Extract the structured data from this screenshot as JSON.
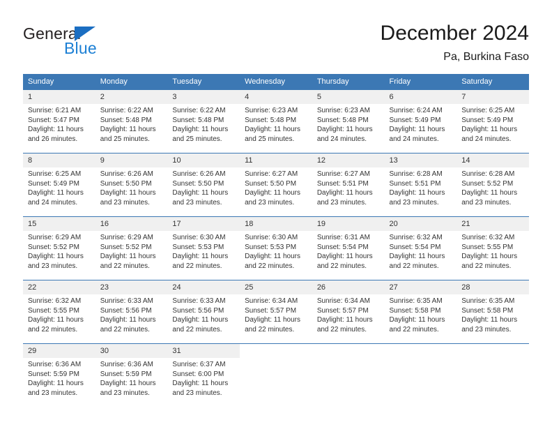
{
  "brand": {
    "name_top": "General",
    "name_bottom": "Blue",
    "accent_color": "#1b7fd4",
    "triangle_color": "#1b6ec2"
  },
  "header": {
    "title": "December 2024",
    "subtitle": "Pa, Burkina Faso",
    "header_bg": "#3c78b4",
    "daynum_bg": "#f0f0f0"
  },
  "weekdays": [
    "Sunday",
    "Monday",
    "Tuesday",
    "Wednesday",
    "Thursday",
    "Friday",
    "Saturday"
  ],
  "weeks": [
    [
      {
        "day": "1",
        "sunrise": "Sunrise: 6:21 AM",
        "sunset": "Sunset: 5:47 PM",
        "daylight1": "Daylight: 11 hours",
        "daylight2": "and 26 minutes."
      },
      {
        "day": "2",
        "sunrise": "Sunrise: 6:22 AM",
        "sunset": "Sunset: 5:48 PM",
        "daylight1": "Daylight: 11 hours",
        "daylight2": "and 25 minutes."
      },
      {
        "day": "3",
        "sunrise": "Sunrise: 6:22 AM",
        "sunset": "Sunset: 5:48 PM",
        "daylight1": "Daylight: 11 hours",
        "daylight2": "and 25 minutes."
      },
      {
        "day": "4",
        "sunrise": "Sunrise: 6:23 AM",
        "sunset": "Sunset: 5:48 PM",
        "daylight1": "Daylight: 11 hours",
        "daylight2": "and 25 minutes."
      },
      {
        "day": "5",
        "sunrise": "Sunrise: 6:23 AM",
        "sunset": "Sunset: 5:48 PM",
        "daylight1": "Daylight: 11 hours",
        "daylight2": "and 24 minutes."
      },
      {
        "day": "6",
        "sunrise": "Sunrise: 6:24 AM",
        "sunset": "Sunset: 5:49 PM",
        "daylight1": "Daylight: 11 hours",
        "daylight2": "and 24 minutes."
      },
      {
        "day": "7",
        "sunrise": "Sunrise: 6:25 AM",
        "sunset": "Sunset: 5:49 PM",
        "daylight1": "Daylight: 11 hours",
        "daylight2": "and 24 minutes."
      }
    ],
    [
      {
        "day": "8",
        "sunrise": "Sunrise: 6:25 AM",
        "sunset": "Sunset: 5:49 PM",
        "daylight1": "Daylight: 11 hours",
        "daylight2": "and 24 minutes."
      },
      {
        "day": "9",
        "sunrise": "Sunrise: 6:26 AM",
        "sunset": "Sunset: 5:50 PM",
        "daylight1": "Daylight: 11 hours",
        "daylight2": "and 23 minutes."
      },
      {
        "day": "10",
        "sunrise": "Sunrise: 6:26 AM",
        "sunset": "Sunset: 5:50 PM",
        "daylight1": "Daylight: 11 hours",
        "daylight2": "and 23 minutes."
      },
      {
        "day": "11",
        "sunrise": "Sunrise: 6:27 AM",
        "sunset": "Sunset: 5:50 PM",
        "daylight1": "Daylight: 11 hours",
        "daylight2": "and 23 minutes."
      },
      {
        "day": "12",
        "sunrise": "Sunrise: 6:27 AM",
        "sunset": "Sunset: 5:51 PM",
        "daylight1": "Daylight: 11 hours",
        "daylight2": "and 23 minutes."
      },
      {
        "day": "13",
        "sunrise": "Sunrise: 6:28 AM",
        "sunset": "Sunset: 5:51 PM",
        "daylight1": "Daylight: 11 hours",
        "daylight2": "and 23 minutes."
      },
      {
        "day": "14",
        "sunrise": "Sunrise: 6:28 AM",
        "sunset": "Sunset: 5:52 PM",
        "daylight1": "Daylight: 11 hours",
        "daylight2": "and 23 minutes."
      }
    ],
    [
      {
        "day": "15",
        "sunrise": "Sunrise: 6:29 AM",
        "sunset": "Sunset: 5:52 PM",
        "daylight1": "Daylight: 11 hours",
        "daylight2": "and 23 minutes."
      },
      {
        "day": "16",
        "sunrise": "Sunrise: 6:29 AM",
        "sunset": "Sunset: 5:52 PM",
        "daylight1": "Daylight: 11 hours",
        "daylight2": "and 22 minutes."
      },
      {
        "day": "17",
        "sunrise": "Sunrise: 6:30 AM",
        "sunset": "Sunset: 5:53 PM",
        "daylight1": "Daylight: 11 hours",
        "daylight2": "and 22 minutes."
      },
      {
        "day": "18",
        "sunrise": "Sunrise: 6:30 AM",
        "sunset": "Sunset: 5:53 PM",
        "daylight1": "Daylight: 11 hours",
        "daylight2": "and 22 minutes."
      },
      {
        "day": "19",
        "sunrise": "Sunrise: 6:31 AM",
        "sunset": "Sunset: 5:54 PM",
        "daylight1": "Daylight: 11 hours",
        "daylight2": "and 22 minutes."
      },
      {
        "day": "20",
        "sunrise": "Sunrise: 6:32 AM",
        "sunset": "Sunset: 5:54 PM",
        "daylight1": "Daylight: 11 hours",
        "daylight2": "and 22 minutes."
      },
      {
        "day": "21",
        "sunrise": "Sunrise: 6:32 AM",
        "sunset": "Sunset: 5:55 PM",
        "daylight1": "Daylight: 11 hours",
        "daylight2": "and 22 minutes."
      }
    ],
    [
      {
        "day": "22",
        "sunrise": "Sunrise: 6:32 AM",
        "sunset": "Sunset: 5:55 PM",
        "daylight1": "Daylight: 11 hours",
        "daylight2": "and 22 minutes."
      },
      {
        "day": "23",
        "sunrise": "Sunrise: 6:33 AM",
        "sunset": "Sunset: 5:56 PM",
        "daylight1": "Daylight: 11 hours",
        "daylight2": "and 22 minutes."
      },
      {
        "day": "24",
        "sunrise": "Sunrise: 6:33 AM",
        "sunset": "Sunset: 5:56 PM",
        "daylight1": "Daylight: 11 hours",
        "daylight2": "and 22 minutes."
      },
      {
        "day": "25",
        "sunrise": "Sunrise: 6:34 AM",
        "sunset": "Sunset: 5:57 PM",
        "daylight1": "Daylight: 11 hours",
        "daylight2": "and 22 minutes."
      },
      {
        "day": "26",
        "sunrise": "Sunrise: 6:34 AM",
        "sunset": "Sunset: 5:57 PM",
        "daylight1": "Daylight: 11 hours",
        "daylight2": "and 22 minutes."
      },
      {
        "day": "27",
        "sunrise": "Sunrise: 6:35 AM",
        "sunset": "Sunset: 5:58 PM",
        "daylight1": "Daylight: 11 hours",
        "daylight2": "and 22 minutes."
      },
      {
        "day": "28",
        "sunrise": "Sunrise: 6:35 AM",
        "sunset": "Sunset: 5:58 PM",
        "daylight1": "Daylight: 11 hours",
        "daylight2": "and 23 minutes."
      }
    ],
    [
      {
        "day": "29",
        "sunrise": "Sunrise: 6:36 AM",
        "sunset": "Sunset: 5:59 PM",
        "daylight1": "Daylight: 11 hours",
        "daylight2": "and 23 minutes."
      },
      {
        "day": "30",
        "sunrise": "Sunrise: 6:36 AM",
        "sunset": "Sunset: 5:59 PM",
        "daylight1": "Daylight: 11 hours",
        "daylight2": "and 23 minutes."
      },
      {
        "day": "31",
        "sunrise": "Sunrise: 6:37 AM",
        "sunset": "Sunset: 6:00 PM",
        "daylight1": "Daylight: 11 hours",
        "daylight2": "and 23 minutes."
      },
      {
        "day": "",
        "sunrise": "",
        "sunset": "",
        "daylight1": "",
        "daylight2": ""
      },
      {
        "day": "",
        "sunrise": "",
        "sunset": "",
        "daylight1": "",
        "daylight2": ""
      },
      {
        "day": "",
        "sunrise": "",
        "sunset": "",
        "daylight1": "",
        "daylight2": ""
      },
      {
        "day": "",
        "sunrise": "",
        "sunset": "",
        "daylight1": "",
        "daylight2": ""
      }
    ]
  ]
}
